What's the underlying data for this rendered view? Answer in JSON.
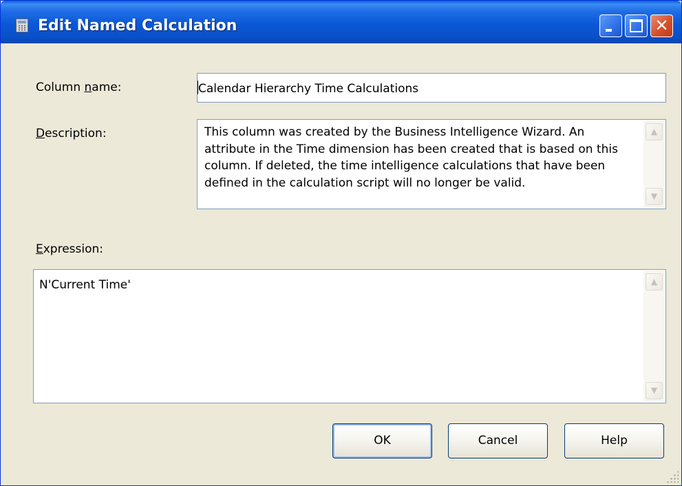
{
  "window": {
    "title": "Edit Named Calculation",
    "title_icon": "calculator-icon",
    "controls": {
      "minimize": "minimize-icon",
      "maximize": "maximize-icon",
      "close": "✕"
    }
  },
  "form": {
    "column_name": {
      "label_pre": "Column ",
      "label_access": "n",
      "label_post": "ame:",
      "value": "Calendar Hierarchy Time Calculations"
    },
    "description": {
      "label_access": "D",
      "label_post": "escription:",
      "value": "This column was created by the Business Intelligence Wizard. An attribute in the Time dimension has been created that is based on this column. If deleted, the time intelligence calculations that have been defined in the calculation script will no longer be valid."
    },
    "expression": {
      "label_access": "E",
      "label_post": "xpression:",
      "value": "N'Current Time'"
    }
  },
  "buttons": {
    "ok": "OK",
    "cancel": "Cancel",
    "help": "Help"
  },
  "scroll": {
    "up": "▲",
    "down": "▼"
  },
  "colors": {
    "title_bar": "#0a58d6",
    "dialog_bg": "#ece9d8",
    "close_button": "#d8502c"
  }
}
